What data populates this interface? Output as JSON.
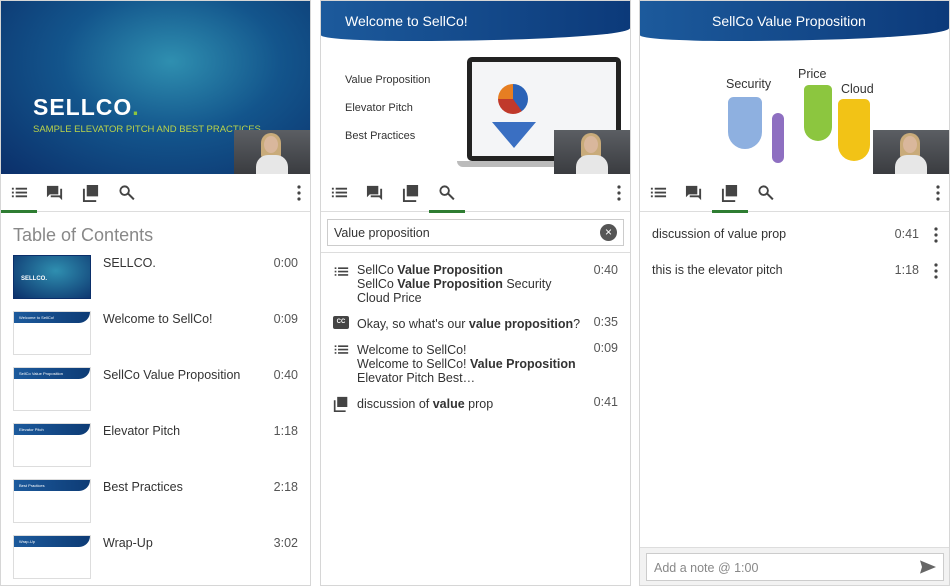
{
  "panels": [
    {
      "slide": {
        "logo": "SELLCO",
        "logo_dot": ".",
        "subtitle": "SAMPLE ELEVATOR PITCH AND BEST PRACTICES"
      },
      "active_tab": "table-of-contents",
      "toc": {
        "title": "Table of Contents",
        "items": [
          {
            "title": "SELLCO.",
            "time": "0:00"
          },
          {
            "title": "Welcome to SellCo!",
            "time": "0:09"
          },
          {
            "title": "SellCo Value Proposition",
            "time": "0:40"
          },
          {
            "title": "Elevator Pitch",
            "time": "1:18"
          },
          {
            "title": "Best Practices",
            "time": "2:18"
          },
          {
            "title": "Wrap-Up",
            "time": "3:02"
          }
        ]
      }
    },
    {
      "slide": {
        "title": "Welcome to SellCo!",
        "items": [
          "Value Proposition",
          "Elevator Pitch",
          "Best Practices"
        ]
      },
      "active_tab": "search",
      "search": {
        "value": "Value proposition",
        "results": [
          {
            "icon": "list-icon",
            "parts": [
              [
                "SellCo ",
                ""
              ],
              [
                "Value Proposition",
                "b"
              ]
            ],
            "parts2": [
              [
                "SellCo ",
                ""
              ],
              [
                "Value Proposition",
                "b"
              ],
              [
                " Security Cloud Price",
                ""
              ]
            ],
            "time": "0:40"
          },
          {
            "icon": "closed-caption-icon",
            "parts": [
              [
                "Okay, so what's our ",
                ""
              ],
              [
                "value proposition",
                "b"
              ],
              [
                "?",
                ""
              ]
            ],
            "time": "0:35"
          },
          {
            "icon": "list-icon",
            "parts": [
              [
                "Welcome to SellCo!",
                ""
              ]
            ],
            "parts2": [
              [
                "Welcome to SellCo! ",
                ""
              ],
              [
                "Value Proposition",
                "b"
              ],
              [
                " Elevator Pitch Best…",
                ""
              ]
            ],
            "time": "0:09"
          },
          {
            "icon": "notes-icon",
            "parts": [
              [
                "discussion of ",
                ""
              ],
              [
                "value",
                "b"
              ],
              [
                " prop",
                ""
              ]
            ],
            "time": "0:41"
          }
        ]
      }
    },
    {
      "slide": {
        "title": "SellCo Value Proposition",
        "labels": [
          "Security",
          "Price",
          "Cloud"
        ]
      },
      "active_tab": "notes",
      "notes": [
        {
          "text": "discussion of value prop",
          "time": "0:41"
        },
        {
          "text": "this is the elevator pitch",
          "time": "1:18"
        }
      ],
      "note_placeholder": "Add a note @ 1:00"
    }
  ],
  "colors": {
    "accent": "#2e7d32",
    "slide_blue": "#0c3a7a"
  }
}
